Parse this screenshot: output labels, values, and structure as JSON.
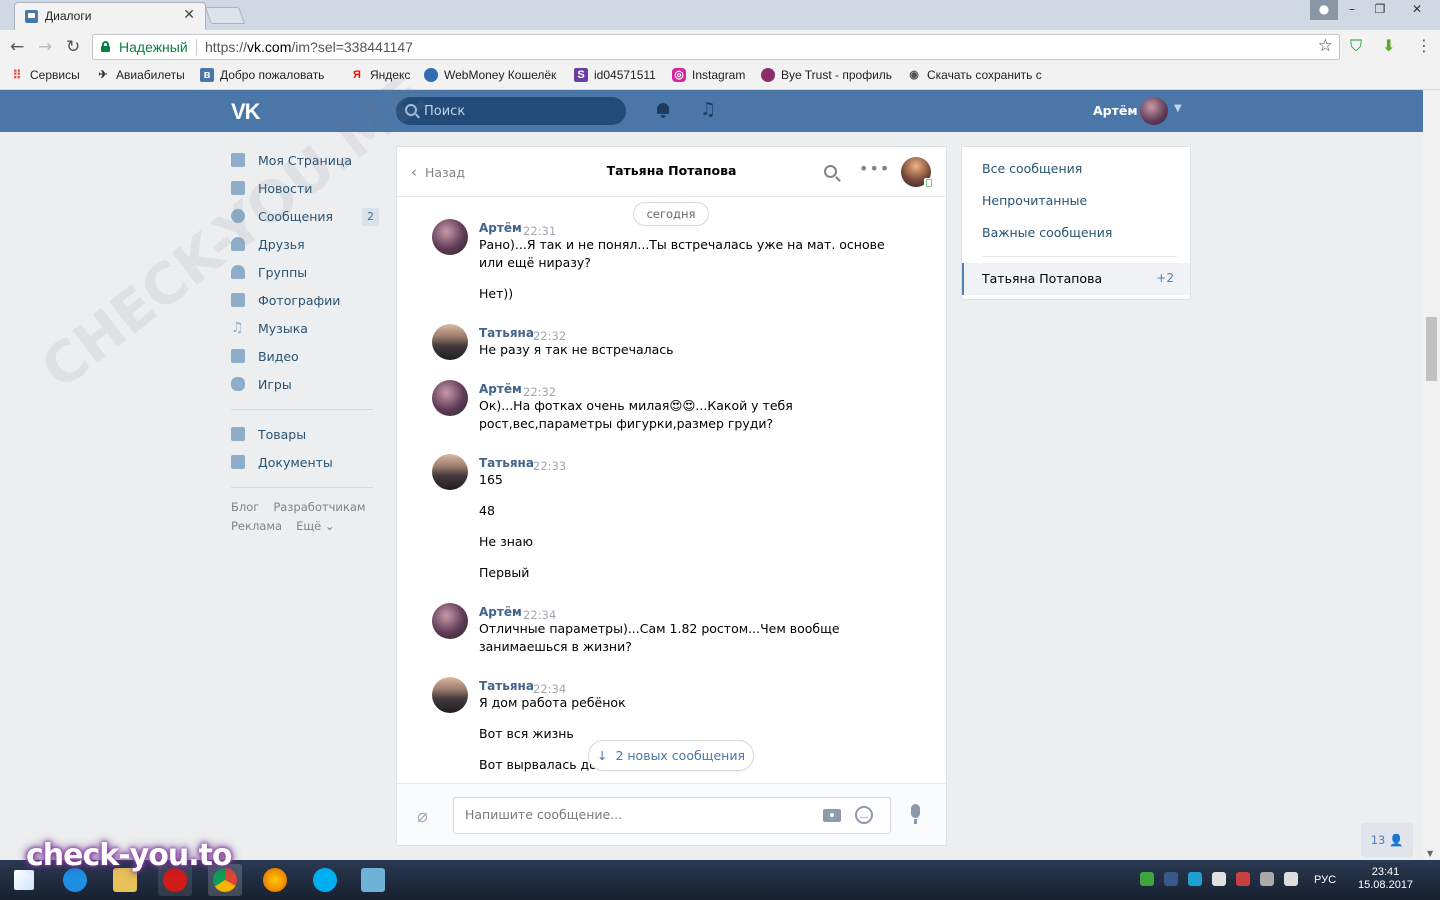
{
  "browser": {
    "tab_title": "Диалоги",
    "secure_label": "Надежный",
    "url_prefix": "https://",
    "url_host": "vk.com",
    "url_path": "/im?sel=338441147",
    "bookmarks": [
      {
        "label": "Сервисы",
        "icon": "apps-icon",
        "color": "#e8453c"
      },
      {
        "label": "Авиабилеты",
        "icon": "plane-icon",
        "color": "#333333"
      },
      {
        "label": "Добро пожаловать",
        "icon": "vk-icon",
        "color": "#4a76a8"
      },
      {
        "label": "Яндекс",
        "icon": "yandex-icon",
        "color": "#e61400"
      },
      {
        "label": "WebMoney Кошелёк",
        "icon": "webmoney-icon",
        "color": "#2f6db5"
      },
      {
        "label": "id04571511",
        "icon": "skype-s-icon",
        "color": "#6a3fa0"
      },
      {
        "label": "Instagram",
        "icon": "instagram-icon",
        "color": "#d6249f"
      },
      {
        "label": "Bye Trust - профиль",
        "icon": "byetrust-icon",
        "color": "#8b2d6b"
      },
      {
        "label": "Скачать сохранить с",
        "icon": "download-icon",
        "color": "#555555"
      }
    ]
  },
  "vk": {
    "logo": "VK",
    "search_placeholder": "Поиск",
    "user_name": "Артём",
    "accent": "#4a76a8"
  },
  "left_menu": {
    "items": [
      {
        "label": "Моя Страница",
        "icon": "home-icon"
      },
      {
        "label": "Новости",
        "icon": "news-icon"
      },
      {
        "label": "Сообщения",
        "icon": "messages-icon",
        "count": "2"
      },
      {
        "label": "Друзья",
        "icon": "friends-icon"
      },
      {
        "label": "Группы",
        "icon": "groups-icon"
      },
      {
        "label": "Фотографии",
        "icon": "camera-icon"
      },
      {
        "label": "Музыка",
        "icon": "music-icon"
      },
      {
        "label": "Видео",
        "icon": "video-icon"
      },
      {
        "label": "Игры",
        "icon": "gamepad-icon"
      }
    ],
    "items2": [
      {
        "label": "Товары",
        "icon": "bag-icon"
      },
      {
        "label": "Документы",
        "icon": "document-icon"
      }
    ],
    "footer": [
      "Блог",
      "Разработчикам",
      "Реклама",
      "Ещё ⌄"
    ]
  },
  "dialog": {
    "back_label": "Назад",
    "title": "Татьяна Потапова",
    "day_label": "сегодня",
    "messages": [
      {
        "author": "Артём",
        "time": "22:31",
        "lines": [
          "Рано)...Я так и не понял...Ты встречалась уже на мат. основе",
          "или ещё ниразу?",
          "",
          "Нет))"
        ]
      },
      {
        "author": "Татьяна",
        "time": "22:32",
        "lines": [
          "Не разу я так не встречалась"
        ]
      },
      {
        "author": "Артём",
        "time": "22:32",
        "lines": [
          "Ок)...На фотках очень милая😍😍...Какой у тебя",
          "рост,вес,параметры фигурки,размер груди?"
        ]
      },
      {
        "author": "Татьяна",
        "time": "22:33",
        "lines": [
          "165",
          "",
          "48",
          "",
          "Не знаю",
          "",
          "Первый"
        ]
      },
      {
        "author": "Артём",
        "time": "22:34",
        "lines": [
          "Отличные параметры)...Сам 1.82 ростом...Чем вообще",
          "занимаешься в жизни?"
        ]
      },
      {
        "author": "Татьяна",
        "time": "22:34",
        "lines": [
          "Я дом работа ребёнок",
          "",
          "Вот вся жизнь",
          "",
          "Вот вырвалась до"
        ]
      }
    ],
    "new_messages_label": "2 новых сообщения",
    "composer_placeholder": "Напишите сообщение..."
  },
  "right_panel": {
    "all_messages": "Все сообщения",
    "unread": "Непрочитанные",
    "important": "Важные сообщения",
    "active_conversation": "Татьяна Потапова",
    "active_count": "+2"
  },
  "online_count": "13",
  "taskbar": {
    "lang": "РУС",
    "time": "23:41",
    "date": "15.08.2017"
  },
  "watermarks": {
    "bottom": "check-you.to",
    "diagonal": "CHECK-YOU.ME"
  }
}
